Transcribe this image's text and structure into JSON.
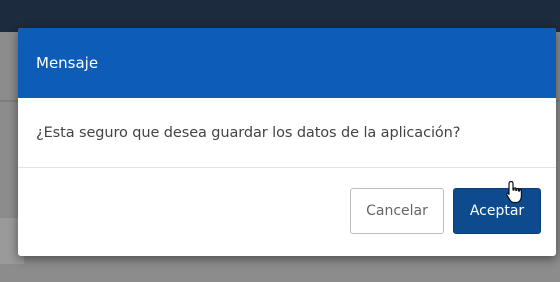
{
  "modal": {
    "title": "Mensaje",
    "message": "¿Esta seguro que desea guardar los datos de la aplicación?",
    "cancel_label": "Cancelar",
    "accept_label": "Aceptar"
  },
  "colors": {
    "header": "#0d5db8",
    "accept_button": "#0e4a8e",
    "app_topbar": "#1d2b3e"
  },
  "icons": {
    "cursor": "hand-pointer-icon"
  }
}
